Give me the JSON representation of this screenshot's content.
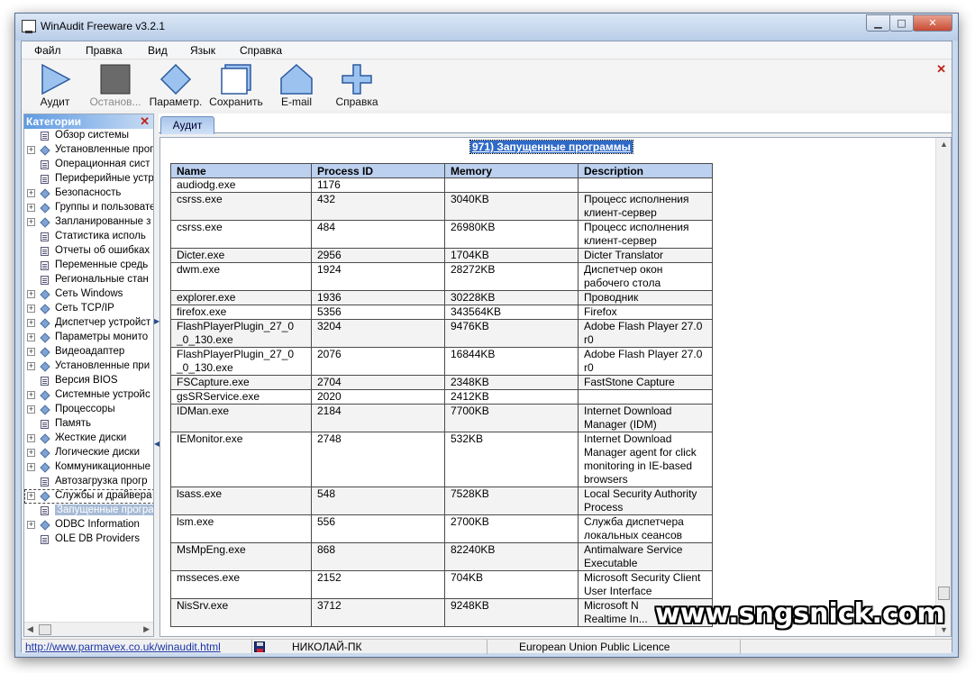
{
  "window": {
    "title": "WinAudit Freeware v3.2.1"
  },
  "menu": [
    "Файл",
    "Правка",
    "Вид",
    "Язык",
    "Справка"
  ],
  "toolbar": {
    "audit": "Аудит",
    "stop": "Останов...",
    "options": "Параметр.",
    "save": "Сохранить",
    "email": "E-mail",
    "help": "Справка"
  },
  "categories": {
    "header": "Категории",
    "items": [
      {
        "label": "Обзор системы",
        "icon": "doc",
        "expandable": false
      },
      {
        "label": "Установленные прог",
        "icon": "diamond",
        "expandable": true
      },
      {
        "label": "Операционная сист",
        "icon": "doc",
        "expandable": false
      },
      {
        "label": "Периферийные устр",
        "icon": "doc",
        "expandable": false
      },
      {
        "label": "Безопасность",
        "icon": "diamond",
        "expandable": true
      },
      {
        "label": "Группы и пользовате",
        "icon": "diamond",
        "expandable": true
      },
      {
        "label": "Запланированные з",
        "icon": "diamond",
        "expandable": true
      },
      {
        "label": "Статистика исполь",
        "icon": "doc",
        "expandable": false
      },
      {
        "label": "Отчеты об ошибках",
        "icon": "doc",
        "expandable": false
      },
      {
        "label": "Переменные средь",
        "icon": "doc",
        "expandable": false
      },
      {
        "label": "Региональные стан",
        "icon": "doc",
        "expandable": false
      },
      {
        "label": "Сеть Windows",
        "icon": "diamond",
        "expandable": true
      },
      {
        "label": "Сеть TCP/IP",
        "icon": "diamond",
        "expandable": true
      },
      {
        "label": "Диспетчер устройст",
        "icon": "diamond",
        "expandable": true
      },
      {
        "label": "Параметры монито",
        "icon": "diamond",
        "expandable": true
      },
      {
        "label": "Видеоадаптер",
        "icon": "diamond",
        "expandable": true
      },
      {
        "label": "Установленные при",
        "icon": "diamond",
        "expandable": true
      },
      {
        "label": "Версия BIOS",
        "icon": "doc",
        "expandable": false
      },
      {
        "label": "Системные устройс",
        "icon": "diamond",
        "expandable": true
      },
      {
        "label": "Процессоры",
        "icon": "diamond",
        "expandable": true
      },
      {
        "label": "Память",
        "icon": "doc",
        "expandable": false
      },
      {
        "label": "Жесткие диски",
        "icon": "diamond",
        "expandable": true
      },
      {
        "label": "Логические диски",
        "icon": "diamond",
        "expandable": true
      },
      {
        "label": "Коммуникационные",
        "icon": "diamond",
        "expandable": true
      },
      {
        "label": "Автозагрузка прогр",
        "icon": "doc",
        "expandable": false
      },
      {
        "label": "Службы и драйвера",
        "icon": "diamond",
        "expandable": true
      },
      {
        "label": "Запущенные програ",
        "icon": "doc",
        "expandable": false
      },
      {
        "label": "ODBC Information",
        "icon": "diamond",
        "expandable": true
      },
      {
        "label": "OLE DB Providers",
        "icon": "doc",
        "expandable": false
      }
    ]
  },
  "tab": "Аудит",
  "report": {
    "title": "971) Запущенные программы",
    "columns": [
      "Name",
      "Process ID",
      "Memory",
      "Description"
    ],
    "rows": [
      [
        "audiodg.exe",
        "1176",
        "",
        ""
      ],
      [
        "csrss.exe",
        "432",
        "3040KB",
        "Процесс исполнения\nклиент-сервер"
      ],
      [
        "csrss.exe",
        "484",
        "26980KB",
        "Процесс исполнения\nклиент-сервер"
      ],
      [
        "Dicter.exe",
        "2956",
        "1704KB",
        "Dicter Translator"
      ],
      [
        "dwm.exe",
        "1924",
        "28272KB",
        "Диспетчер окон\nрабочего стола"
      ],
      [
        "explorer.exe",
        "1936",
        "30228KB",
        "Проводник"
      ],
      [
        "firefox.exe",
        "5356",
        "343564KB",
        "Firefox"
      ],
      [
        "FlashPlayerPlugin_27_0\n_0_130.exe",
        "3204",
        "9476KB",
        "Adobe Flash Player 27.0\nr0"
      ],
      [
        "FlashPlayerPlugin_27_0\n_0_130.exe",
        "2076",
        "16844KB",
        "Adobe Flash Player 27.0\nr0"
      ],
      [
        "FSCapture.exe",
        "2704",
        "2348KB",
        "FastStone Capture"
      ],
      [
        "gsSRService.exe",
        "2020",
        "2412KB",
        ""
      ],
      [
        "IDMan.exe",
        "2184",
        "7700KB",
        "Internet Download\nManager (IDM)"
      ],
      [
        "IEMonitor.exe",
        "2748",
        "532KB",
        "Internet Download\nManager agent for click\nmonitoring in IE-based\nbrowsers"
      ],
      [
        "lsass.exe",
        "548",
        "7528KB",
        "Local Security Authority\nProcess"
      ],
      [
        "lsm.exe",
        "556",
        "2700KB",
        "Служба диспетчера\nлокальных сеансов"
      ],
      [
        "MsMpEng.exe",
        "868",
        "82240KB",
        "Antimalware Service\nExecutable"
      ],
      [
        "msseces.exe",
        "2152",
        "704KB",
        "Microsoft Security Client\nUser Interface"
      ],
      [
        "NisSrv.exe",
        "3712",
        "9248KB",
        "Microsoft N\nRealtime In..."
      ]
    ]
  },
  "status": {
    "url": "http://www.parmavex.co.uk/winaudit.html",
    "computer": "НИКОЛАЙ-ПК",
    "licence": "European Union Public Licence"
  },
  "watermark": "www.sngsnick.com"
}
